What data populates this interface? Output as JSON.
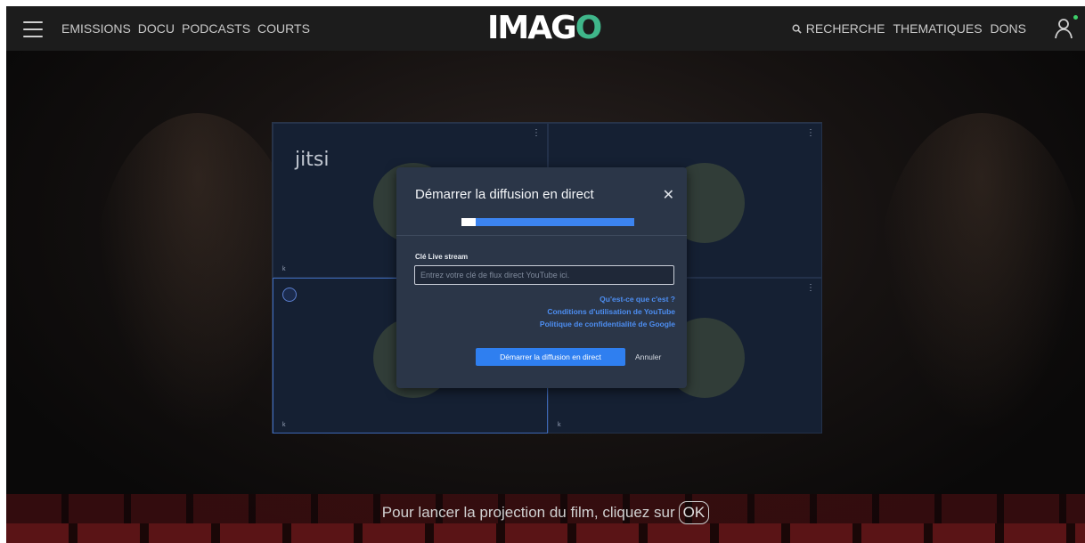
{
  "header": {
    "logo_text": "IMAGO",
    "nav_left": [
      {
        "label": "EMISSIONS"
      },
      {
        "label": "DOCU"
      },
      {
        "label": "PODCASTS"
      },
      {
        "label": "COURTS"
      }
    ],
    "nav_right": {
      "search_label": "RECHERCHE",
      "thematiques_label": "THEMATIQUES",
      "dons_label": "DONS"
    },
    "icons": {
      "menu": "hamburger-icon",
      "search": "search-icon",
      "user": "user-icon"
    },
    "online_color": "#3ed06a"
  },
  "video": {
    "watermark": "jitsi",
    "tiles": [
      {
        "name": "k"
      },
      {
        "name": ""
      },
      {
        "name": "k"
      },
      {
        "name": "k"
      }
    ]
  },
  "dialog": {
    "title": "Démarrer la diffusion en direct",
    "progress": 0.08,
    "field_label": "Clé Live stream",
    "input_placeholder": "Entrez votre clé de flux direct YouTube ici.",
    "input_value": "",
    "links": [
      "Qu'est-ce que c'est ?",
      "Conditions d'utilisation de YouTube",
      "Politique de confidentialité de Google"
    ],
    "primary_button": "Démarrer la diffusion en direct",
    "cancel_button": "Annuler",
    "accent_color": "#2f7ff0"
  },
  "caption": {
    "text": "Pour lancer la projection du film, cliquez sur",
    "ok_label": "OK"
  }
}
